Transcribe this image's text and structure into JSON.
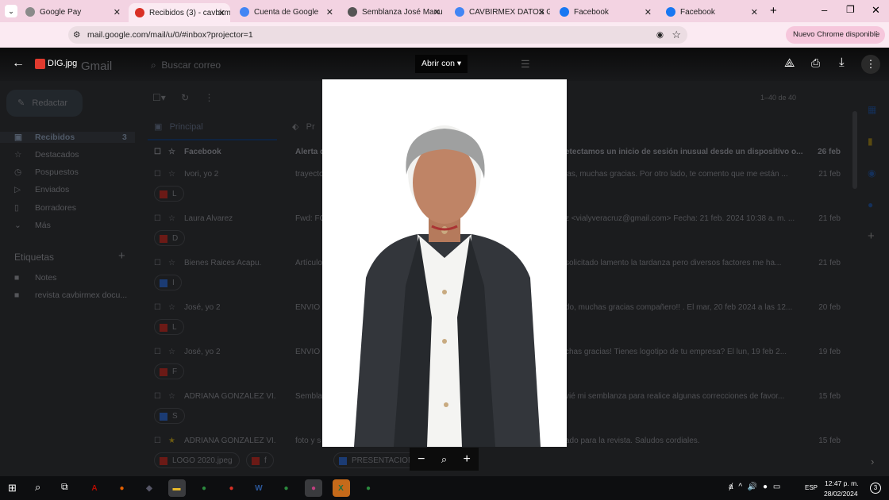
{
  "browser": {
    "tabs": [
      {
        "label": "Google Pay",
        "color": "#8a8a8a"
      },
      {
        "label": "Recibidos (3) - cavbirm",
        "color": "#d93025",
        "active": true
      },
      {
        "label": "Cuenta de Google",
        "color": "#4285f4"
      },
      {
        "label": "Semblanza José Manu",
        "color": "#555"
      },
      {
        "label": "CAVBIRMEX DATOS GE",
        "color": "#4285f4"
      },
      {
        "label": "Facebook",
        "color": "#1877f2"
      },
      {
        "label": "Facebook",
        "color": "#1877f2"
      }
    ],
    "url": "mail.google.com/mail/u/0/#inbox?projector=1",
    "update_label": "Nuevo Chrome disponible",
    "profile_initial": "C"
  },
  "viewer": {
    "file_name": "DIG.jpg",
    "open_with": "Abrir con"
  },
  "gmail": {
    "logo": "Gmail",
    "search_placeholder": "Buscar correo",
    "compose": "Redactar",
    "nav": [
      {
        "label": "Recibidos",
        "count": "3",
        "icon": "inbox-icon"
      },
      {
        "label": "Destacados",
        "icon": "star-icon"
      },
      {
        "label": "Pospuestos",
        "icon": "clock-icon"
      },
      {
        "label": "Enviados",
        "icon": "send-icon"
      },
      {
        "label": "Borradores",
        "icon": "draft-icon"
      },
      {
        "label": "Más",
        "icon": "chevron-down-icon"
      }
    ],
    "labels_title": "Etiquetas",
    "labels": [
      "Notes",
      "revista cavbirmex docu..."
    ],
    "tab_principal": "Principal",
    "tab_promo": "Pr",
    "pagination": "1–40 de 40",
    "emails": [
      {
        "sender": "Facebook",
        "subject": "Alerta d",
        "snippet": "etectamos un inicio de sesión inusual desde un dispositivo o...",
        "date": "26 feb",
        "unread": true
      },
      {
        "sender": "Ivori, yo 2",
        "subject": "trayecto",
        "snippet": "las, muchas gracias. Por otro lado, te comento que me están ...",
        "date": "21 feb",
        "attachments": [
          {
            "name": "L",
            "type": "image"
          }
        ]
      },
      {
        "sender": "Laura Alvarez",
        "subject": "Fwd: FC",
        "snippet": "z <vialyveracruz@gmail.com> Fecha: 21 feb. 2024 10:38 a. m. ...",
        "date": "21 feb",
        "attachments": [
          {
            "name": "D",
            "type": "image"
          }
        ]
      },
      {
        "sender": "Bienes Raices Acapu.",
        "subject": "Artículo",
        "snippet": "solicitado lamento la tardanza pero diversos factores me ha...",
        "date": "21 feb",
        "attachments": [
          {
            "name": "I",
            "type": "word"
          }
        ]
      },
      {
        "sender": "José, yo 2",
        "subject": "ENVIO",
        "snippet": "do, muchas gracias compañero!! . El mar, 20 feb 2024 a las 12...",
        "date": "20 feb",
        "attachments": [
          {
            "name": "L",
            "type": "image"
          }
        ]
      },
      {
        "sender": "José, yo 2",
        "subject": "ENVIO",
        "snippet": "chas gracias! Tienes logotipo de tu empresa? El lun, 19 feb 2...",
        "date": "19 feb",
        "attachments": [
          {
            "name": "F",
            "type": "image"
          }
        ]
      },
      {
        "sender": "ADRIANA GONZALEZ VI.",
        "subject": "Sembla",
        "snippet": "vié mi semblanza para realice algunas correcciones de favor...",
        "date": "15 feb",
        "attachments": [
          {
            "name": "S",
            "type": "word"
          }
        ]
      },
      {
        "sender": "ADRIANA GONZALEZ VI.",
        "subject": "foto y s",
        "snippet": "ado para la revista. Saludos cordiales.",
        "date": "15 feb",
        "starred": true,
        "attachments": [
          {
            "name": "LOGO 2020.jpeg",
            "type": "image"
          },
          {
            "name": "f",
            "type": "image"
          },
          {
            "name": "PRESENTACION...",
            "type": "word"
          },
          {
            "name": "+1",
            "type": "more"
          }
        ]
      }
    ]
  },
  "zoom_controls": {
    "zoom_out": "−",
    "zoom_in": "+"
  },
  "taskbar": {
    "apps": [
      {
        "name": "acrobat",
        "color": "#b30b00",
        "glyph": "A"
      },
      {
        "name": "firefox",
        "color": "#e66000",
        "glyph": "●"
      },
      {
        "name": "app",
        "color": "#556",
        "glyph": "◆"
      },
      {
        "name": "file-explorer",
        "color": "#e8b92a",
        "glyph": "▬"
      },
      {
        "name": "chrome",
        "color": "#2b8a3e",
        "glyph": "●"
      },
      {
        "name": "chrome-profile",
        "color": "#d93025",
        "glyph": "●"
      },
      {
        "name": "word",
        "color": "#2b579a",
        "glyph": "W"
      },
      {
        "name": "chrome-profile",
        "color": "#2b8a3e",
        "glyph": "●"
      },
      {
        "name": "chrome-active",
        "color": "#c04080",
        "glyph": "●"
      },
      {
        "name": "excel",
        "color": "#1d6f42",
        "glyph": "X"
      },
      {
        "name": "chrome-profile",
        "color": "#2b8a3e",
        "glyph": "●"
      }
    ],
    "language": "ESP",
    "time": "12:47 p. m.",
    "date": "28/02/2024",
    "notifications": "3"
  }
}
